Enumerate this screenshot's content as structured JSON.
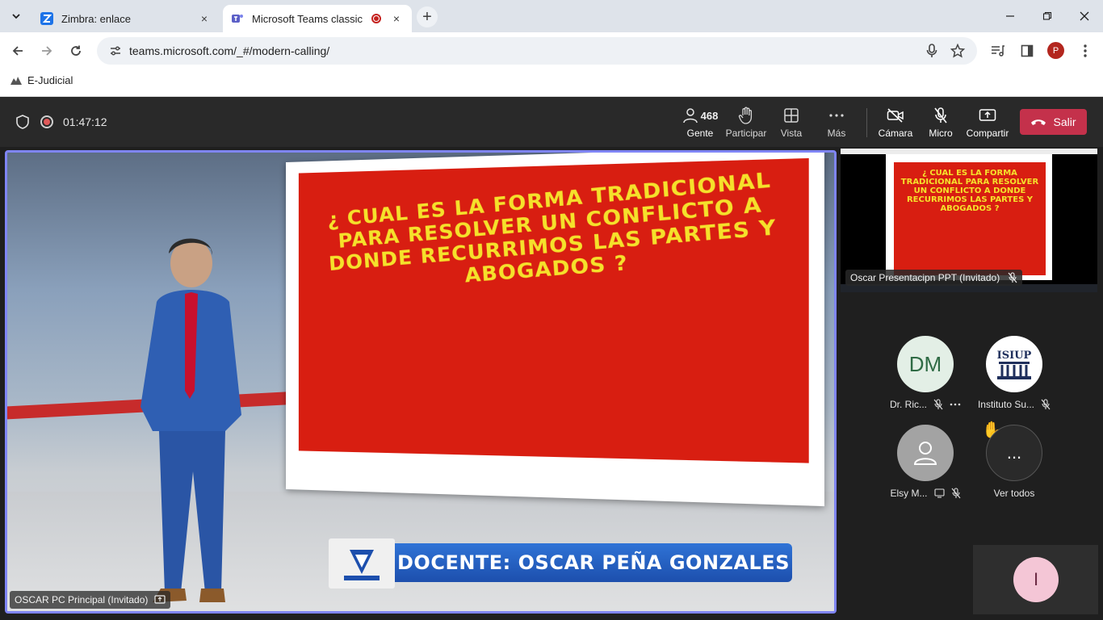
{
  "browser": {
    "tabs": [
      {
        "title": "Zimbra: enlace",
        "favicon": "zimbra-icon",
        "close": "×"
      },
      {
        "title": "Microsoft Teams classic",
        "favicon": "teams-icon",
        "close": "×"
      }
    ],
    "new_tab": "+",
    "url": "teams.microsoft.com/_#/modern-calling/",
    "profile_initial": "P",
    "bookmarks": [
      {
        "label": "E-Judicial"
      }
    ]
  },
  "meeting": {
    "timer": "01:47:12",
    "people_count": "468",
    "controls": {
      "people": "Gente",
      "raise_hand": "Participar",
      "view": "Vista",
      "more": "Más",
      "camera": "Cámara",
      "mic": "Micro",
      "share": "Compartir",
      "leave": "Salir"
    },
    "main_video": {
      "label": "OSCAR PC Principal (Invitado)",
      "slide_text": "¿ CUAL ES LA FORMA TRADICIONAL PARA RESOLVER UN CONFLICTO A DONDE RECURRIMOS LAS PARTES Y ABOGADOS ?",
      "lower_third": "DOCENTE: OSCAR PEÑA GONZALES"
    },
    "share_thumb": {
      "label": "Oscar Presentacipn PPT (Invitado)",
      "slide_text": "¿ CUAL ES LA FORMA TRADICIONAL PARA RESOLVER UN CONFLICTO A DONDE RECURRIMOS LAS PARTES Y ABOGADOS ?"
    },
    "participants": [
      {
        "initials": "DM",
        "name": "Dr. Ric..."
      },
      {
        "logo_text": "ISIUP",
        "name": "Instituto Su..."
      },
      {
        "name": "Elsy M..."
      },
      {
        "more": "...",
        "name": "Ver todos"
      }
    ],
    "self_initial": "I"
  }
}
